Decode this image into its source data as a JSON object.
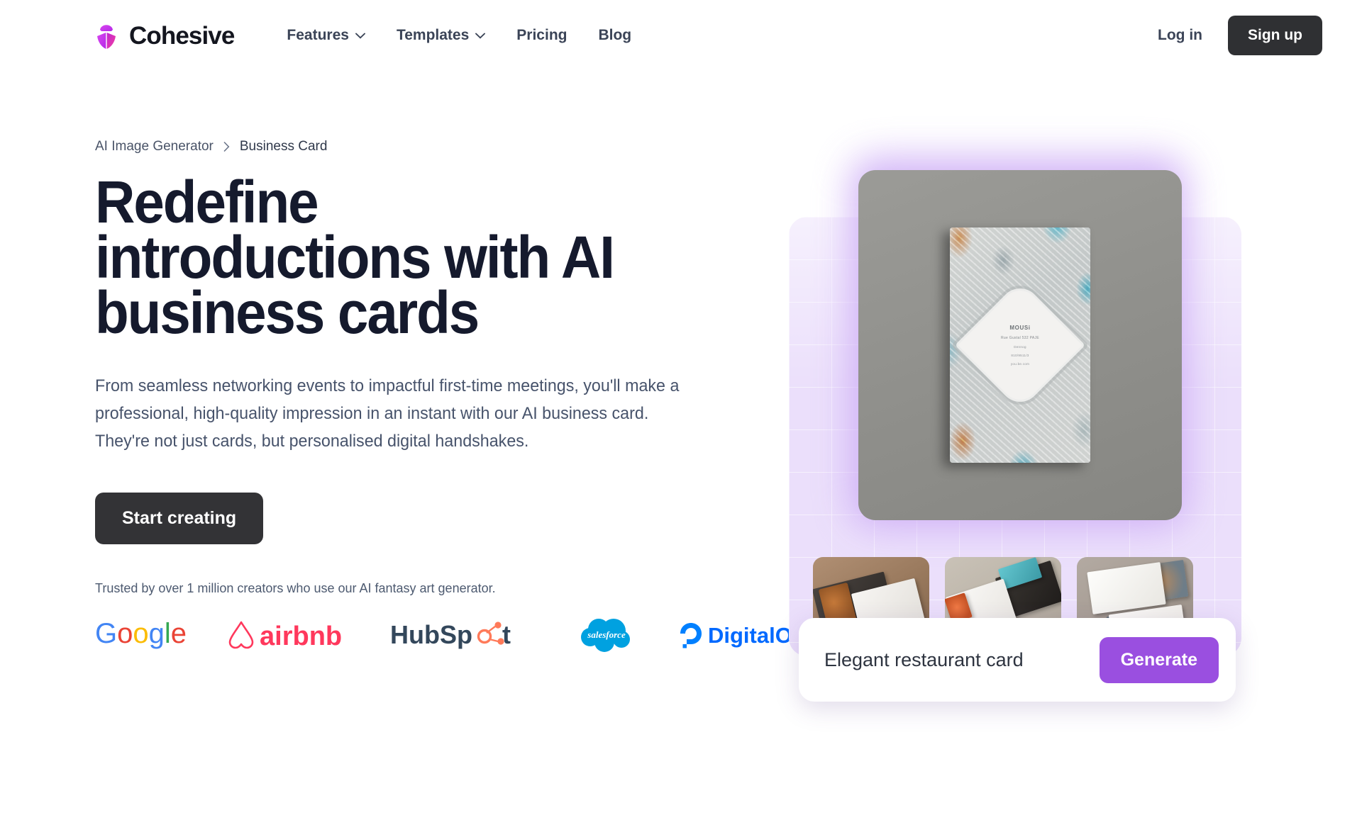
{
  "brand": {
    "name": "Cohesive",
    "logo_icon": "cohesive-boat-logo",
    "colors": {
      "logo_from": "#d946ef",
      "logo_to": "#c026d3"
    }
  },
  "nav": {
    "links": [
      {
        "label": "Features",
        "has_dropdown": true,
        "icon": "chevron-down-icon"
      },
      {
        "label": "Templates",
        "has_dropdown": true,
        "icon": "chevron-down-icon"
      },
      {
        "label": "Pricing",
        "has_dropdown": false
      },
      {
        "label": "Blog",
        "has_dropdown": false
      }
    ],
    "login_label": "Log in",
    "signup_label": "Sign up",
    "signup_bg": "#2f3033"
  },
  "breadcrumb": {
    "items": [
      {
        "label": "AI Image Generator"
      },
      {
        "label": "Business Card"
      }
    ],
    "separator_icon": "chevron-right-icon"
  },
  "hero": {
    "headline_line1": "Redefine",
    "headline_line2": "introductions with AI",
    "headline_line3": "business cards",
    "subcopy": "From seamless networking events to impactful first-time meetings, you'll make a professional, high-quality impression in an instant with our AI business card. They're not just cards, but personalised digital handshakes.",
    "cta_label": "Start creating",
    "cta_bg": "#333336",
    "trusted_text": "Trusted by over 1 million creators who use our AI fantasy art generator."
  },
  "logos": [
    {
      "name": "Google",
      "icon": "google-logo"
    },
    {
      "name": "airbnb",
      "icon": "airbnb-logo"
    },
    {
      "name": "HubSpot",
      "icon": "hubspot-logo"
    },
    {
      "name": "salesforce",
      "icon": "salesforce-logo"
    },
    {
      "name": "DigitalOcean",
      "icon": "digitalocean-logo"
    }
  ],
  "preview": {
    "main_card": {
      "name": "MOUSi",
      "line1": "Rue Gustal 532 PAJE",
      "line2": "Dennog",
      "line3": "810/9511/3",
      "line4": "you.be.com"
    },
    "thumbnails": [
      {
        "alt": "business card mockup on wood desk"
      },
      {
        "alt": "teal and black business card stack"
      },
      {
        "alt": "white ornate business cards"
      }
    ],
    "prompt_value": "Elegant restaurant card",
    "prompt_placeholder": "Elegant restaurant card",
    "generate_label": "Generate",
    "generate_bg": "#9a4fe0",
    "panel_bg": "#ebdffb"
  }
}
